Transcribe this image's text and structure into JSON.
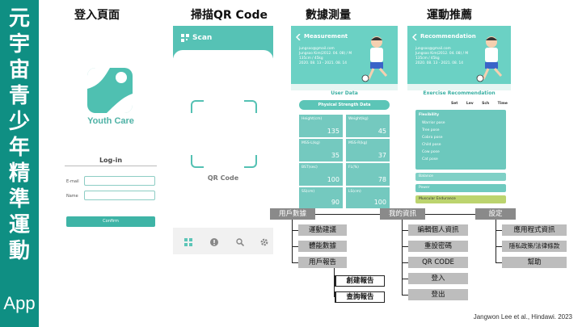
{
  "banner": {
    "chars": [
      "元",
      "宇",
      "宙",
      "青",
      "少",
      "年",
      "精",
      "準",
      "運",
      "動"
    ],
    "app": "App"
  },
  "titles": {
    "login": "登入頁面",
    "scan": "掃描QR Code",
    "measure": "數據測量",
    "recommend": "運動推薦"
  },
  "login": {
    "brand": "Youth Care",
    "heading": "Log-in",
    "email_label": "E-mail",
    "name_label": "Name",
    "confirm": "Confirm"
  },
  "scan": {
    "title": "Scan",
    "qr_label": "QR Code"
  },
  "measure": {
    "header": "Measurement",
    "profile": [
      "jungsoo@gmail.com",
      "Jungsoo Kim(2012. 04. 08) / M",
      "135cm / 45kg",
      "2020. 08. 13 - 2021. 08. 14"
    ],
    "section": "User Data",
    "sub": "Physical Strength Data",
    "cells": [
      {
        "k": "Height(cm)",
        "v": "135"
      },
      {
        "k": "Weight(kg)",
        "v": "45"
      },
      {
        "k": "MSS-L(kg)",
        "v": "35"
      },
      {
        "k": "MSS-R(kg)",
        "v": "37"
      },
      {
        "k": "BST(sec)",
        "v": "100"
      },
      {
        "k": "FL(%)",
        "v": "78"
      },
      {
        "k": "SS(cm)",
        "v": "90"
      },
      {
        "k": "LS(cm)",
        "v": "100"
      }
    ]
  },
  "recommend": {
    "header": "Recommendation",
    "profile": [
      "jungsoo@gmail.com",
      "Jungsoo Kim(2012. 04. 08) / M",
      "135cm / 45kg",
      "2020. 08. 13 - 2021. 08. 14"
    ],
    "section": "Exercise Recommendation",
    "cols": [
      "Set",
      "Lev",
      "Sch",
      "Time"
    ],
    "group": "Flexibility",
    "poses": [
      "Warrior pose",
      "Tree pose",
      "Cobra pose",
      "Child pose",
      "Cow pose",
      "Cat pose"
    ],
    "bars": [
      "Balance",
      "Power",
      "Muscular Endurance"
    ],
    "colors": {
      "balance": "#7fd0c6",
      "power": "#6fcabf",
      "endurance": "#bcd46e"
    }
  },
  "tree": {
    "root1": "用戶數據",
    "root1_children": [
      "運動建議",
      "體能數據",
      "用戶報告"
    ],
    "report_children": [
      "創建報告",
      "查詢報告"
    ],
    "root2": "我的資訊",
    "root2_children": [
      "編輯個人資訊",
      "重設密碼",
      "QR CODE",
      "登入",
      "登出"
    ],
    "root3": "設定",
    "root3_children": [
      "應用程式資訊",
      "隱私政策/法律條款",
      "幫助"
    ]
  },
  "citation": "Jangwon Lee et al., Hindawi. 2023"
}
